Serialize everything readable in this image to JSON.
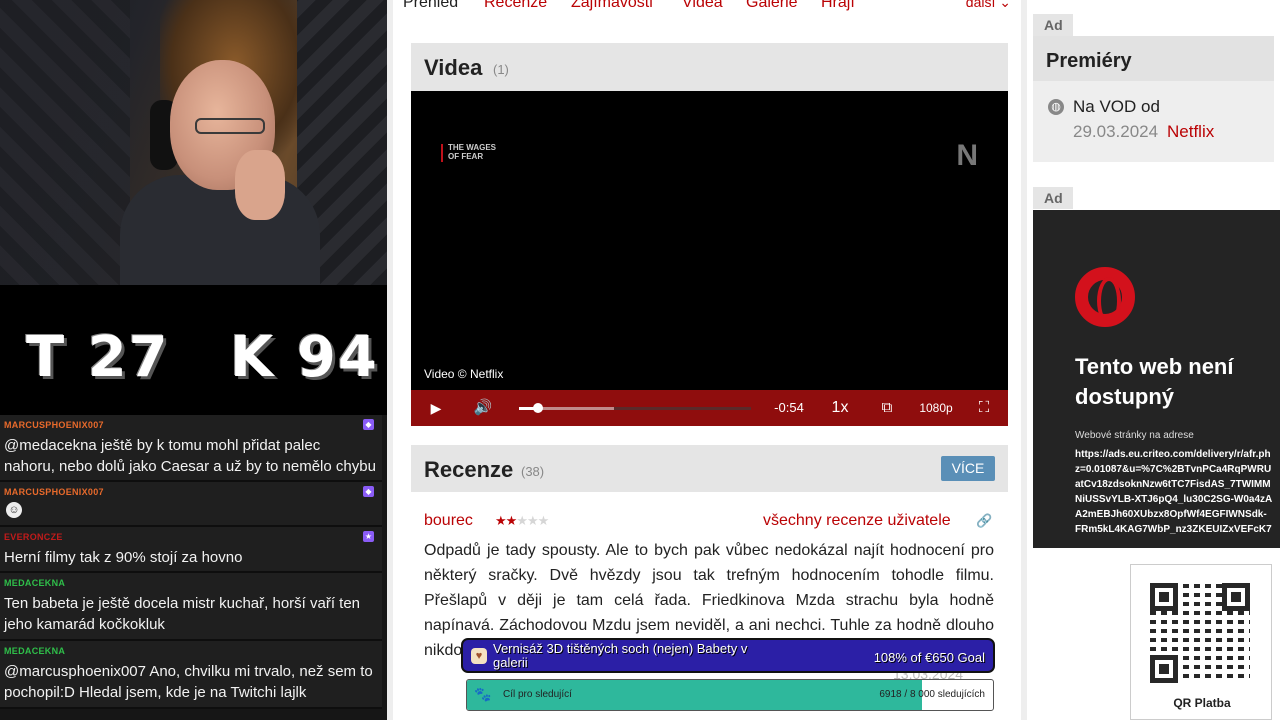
{
  "stream": {
    "score_t": "T 27",
    "score_k": "K 94",
    "chat": [
      {
        "user": "MARCUSPHOENIX007",
        "user_color": "#e86a2b",
        "text": "@medacekna ještě by k tomu mohl přidat palec",
        "text2": "nahoru, nebo dolů jako Caesar a už by to nemělo chybu"
      },
      {
        "user": "MARCUSPHOENIX007",
        "user_color": "#e86a2b",
        "emote": "☺"
      },
      {
        "user": "EVERONCZE",
        "user_color": "#c21b1b",
        "text": "Herní filmy tak z 90% stojí za hovno"
      },
      {
        "user": "MEDACEKNA",
        "user_color": "#2fbf4a",
        "text": "Ten babeta je ještě docela mistr kuchař, horší vaří ten",
        "text2": "jeho kamarád kočkokluk"
      },
      {
        "user": "MEDACEKNA",
        "user_color": "#2fbf4a",
        "text": "@marcusphoenix007 Ano, chvilku mi trvalo, než sem to",
        "text2": "pochopil:D Hledal jsem, kde je na Twitchi lajlk"
      }
    ]
  },
  "film_page": {
    "tabs": [
      "Přehled",
      "Recenze",
      "Zajímavosti",
      "Videa",
      "Galerie",
      "Hrají"
    ],
    "tab_more": "další",
    "videos": {
      "title": "Videa",
      "count": "(1)",
      "watermark_line1": "THE WAGES",
      "watermark_line2": "OF FEAR",
      "logo": "N",
      "copyright": "Video © Netflix",
      "time": "-0:54",
      "speed": "1x",
      "quality": "1080p",
      "progress": 0.08
    },
    "reviews": {
      "title": "Recenze",
      "count": "(38)",
      "more_label": "VÍCE",
      "user": "bourec",
      "rating": 2,
      "rating_max": 5,
      "all_reviews_label": "všechny recenze uživatele",
      "text": "Odpadů je tady spousty. Ale to bych pak vůbec nedokázal najít hodnocení pro některý sračky. Dvě hvězdy jsou tak trefným hodnocením tohodle filmu. Přešlapů v ději je tam celá řada. Friedkinova Mzda strachu byla hodně napínavá. Záchodovou Mzdu jsem neviděl, a ani nechci. Tuhle za hodně dlouho nikdo, protože z Netflixu rychle vyšumí. Stejně jako obludy bubby obětuje. 40%",
      "date": "13.03.2024"
    }
  },
  "overlays": {
    "goal_title": "Vernisáž 3D tištěných soch (nejen) Babety v galerii",
    "goal_amount": "108% of €650 Goal",
    "followers_label": "Cíl pro sledující",
    "followers_count": "6918 / 8 000 sledujících",
    "followers_progress": 0.8648
  },
  "sidebar": {
    "ad_label": "Ad",
    "premiery_title": "Premiéry",
    "vod_label": "Na VOD od",
    "vod_date": "29.03.2024",
    "vod_service": "Netflix",
    "ad2_title": "Tento web není dostupný",
    "ad2_sub": "Webové stránky na adrese",
    "ad2_url_lines": [
      "https://ads.eu.criteo.com/delivery/r/afr.ph",
      "z=0.01087&u=%7C%2BTvnPCa4RqPWRU",
      "atCv18zdsoknNzw6tTC7FisdAS_7TWIMM",
      "NiUSSvYLB-XTJ6pQ4_lu30C2SG-W0a4zA",
      "A2mEBJh60XUbzx8OpfWf4EGFIWNSdk-",
      "FRm5kL4KAG7WbP_nz3ZKEUIZxVEFcK7"
    ],
    "qr_label": "QR Platba"
  },
  "colors": {
    "accent": "#ba0305",
    "player_bar": "#8f0d0d",
    "button_blue": "#5a8fb7",
    "goal_bg": "#2b1fa6",
    "followers_fill": "#2eb89c"
  }
}
